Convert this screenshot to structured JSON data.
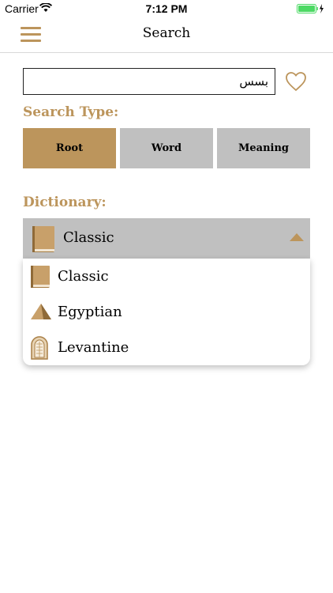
{
  "status_bar": {
    "carrier": "Carrier",
    "time": "7:12 PM"
  },
  "nav": {
    "title": "Search",
    "menu_icon": "hamburger-menu-icon"
  },
  "search": {
    "value": "بسس",
    "favorite_icon": "heart-outline-icon"
  },
  "search_type": {
    "label": "Search Type:",
    "options": [
      "Root",
      "Word",
      "Meaning"
    ],
    "selected": "Root"
  },
  "dictionary": {
    "label": "Dictionary:",
    "selected": "Classic",
    "options": [
      {
        "label": "Classic",
        "icon": "book-icon"
      },
      {
        "label": "Egyptian",
        "icon": "pyramid-icon"
      },
      {
        "label": "Levantine",
        "icon": "arch-window-icon"
      }
    ]
  },
  "colors": {
    "accent": "#bc955c",
    "inactive": "#c0c0c0",
    "battery": "#4cd964"
  }
}
